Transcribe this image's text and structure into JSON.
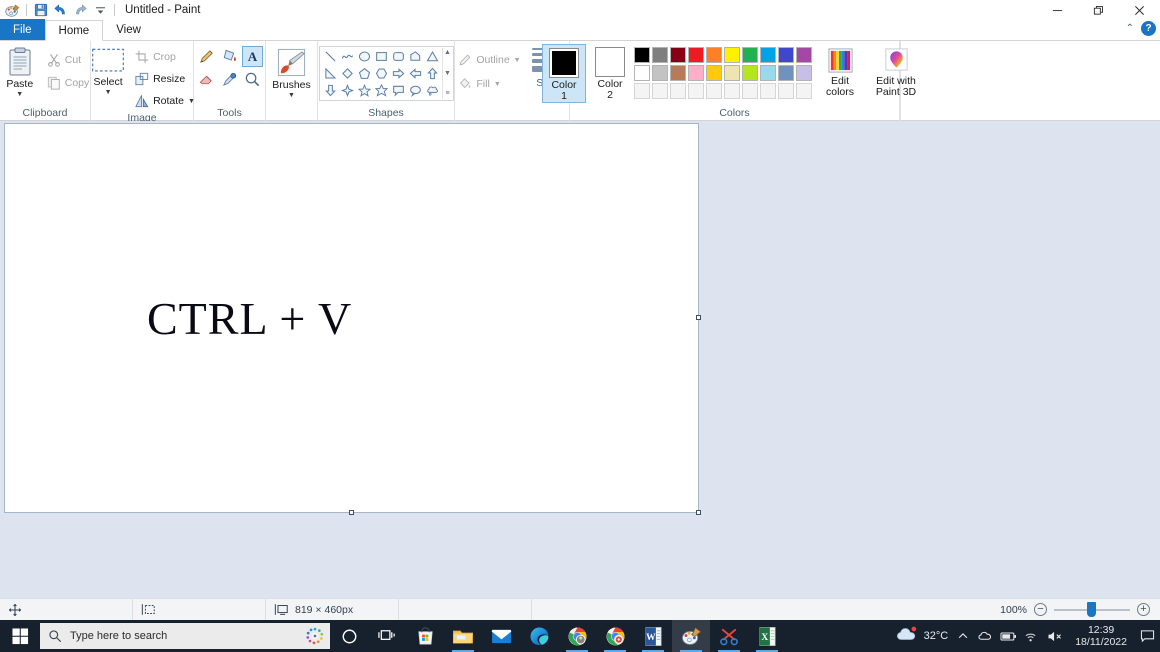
{
  "window": {
    "title": "Untitled - Paint",
    "quick_access": [
      {
        "name": "paint-app-icon",
        "glyph": "paint"
      },
      {
        "name": "save-icon",
        "glyph": "save"
      },
      {
        "name": "undo-icon",
        "glyph": "undo"
      },
      {
        "name": "redo-icon",
        "glyph": "redo"
      },
      {
        "name": "customize-qat-icon",
        "glyph": "chevron-down-bar"
      }
    ],
    "controls": {
      "minimize": "—",
      "restore": "❐",
      "close": "✕",
      "collapse_ribbon": "⌃",
      "help": "?"
    }
  },
  "tabs": [
    {
      "label": "File",
      "state": "file"
    },
    {
      "label": "Home",
      "state": "active"
    },
    {
      "label": "View",
      "state": "normal"
    }
  ],
  "ribbon": {
    "clipboard": {
      "label": "Clipboard",
      "paste": {
        "label": "Paste",
        "has_caret": true
      },
      "cut": {
        "label": "Cut",
        "disabled": true
      },
      "copy": {
        "label": "Copy",
        "disabled": true
      }
    },
    "image": {
      "label": "Image",
      "select": {
        "label": "Select",
        "has_caret": true
      },
      "crop": {
        "label": "Crop",
        "disabled": true
      },
      "resize": {
        "label": "Resize",
        "disabled": false
      },
      "rotate": {
        "label": "Rotate",
        "disabled": false,
        "has_caret": true
      }
    },
    "tools": {
      "label": "Tools",
      "items": [
        {
          "name": "pencil-tool",
          "selected": false
        },
        {
          "name": "fill-with-color-tool",
          "selected": false
        },
        {
          "name": "text-tool",
          "selected": true
        },
        {
          "name": "eraser-tool",
          "selected": false
        },
        {
          "name": "color-picker-tool",
          "selected": false
        },
        {
          "name": "magnifier-tool",
          "selected": false
        }
      ]
    },
    "brushes": {
      "label": "Brushes",
      "has_caret": true
    },
    "shapes": {
      "label": "Shapes",
      "items": [
        "line",
        "curve",
        "oval",
        "rectangle",
        "rounded-rectangle",
        "polygon",
        "triangle",
        "right-triangle",
        "diamond",
        "pentagon",
        "hexagon",
        "right-arrow",
        "left-arrow",
        "up-arrow",
        "down-arrow",
        "four-point-star",
        "five-point-star",
        "six-point-star",
        "rounded-callout",
        "oval-callout",
        "cloud-callout"
      ],
      "scroll": {
        "up": "▲",
        "down": "▼",
        "more": "≡"
      }
    },
    "outline": {
      "label": "Outline",
      "disabled": true,
      "has_caret": true
    },
    "fill": {
      "label": "Fill",
      "disabled": true,
      "has_caret": true
    },
    "size": {
      "label": "Size",
      "has_caret": true,
      "thicknesses": [
        1,
        2,
        3,
        5
      ]
    },
    "colors": {
      "label": "Colors",
      "color1": {
        "label_line1": "Color",
        "label_line2": "1",
        "value": "#000000",
        "selected": true
      },
      "color2": {
        "label_line1": "Color",
        "label_line2": "2",
        "value": "#ffffff",
        "selected": false
      },
      "palette_row1": [
        "#000000",
        "#7f7f7f",
        "#880015",
        "#ed1c24",
        "#ff7f27",
        "#fff200",
        "#22b14c",
        "#00a2e8",
        "#3f48cc",
        "#a349a4"
      ],
      "palette_row2": [
        "#ffffff",
        "#c3c3c3",
        "#b97a57",
        "#ffaec9",
        "#ffc90e",
        "#efe4b0",
        "#b5e61d",
        "#99d9ea",
        "#7092be",
        "#c8bfe7"
      ],
      "palette_row3": [
        "",
        "",
        "",
        "",
        "",
        "",
        "",
        "",
        "",
        ""
      ],
      "edit_colors": {
        "label_line1": "Edit",
        "label_line2": "colors"
      },
      "paint3d": {
        "label_line1": "Edit with",
        "label_line2": "Paint 3D"
      }
    }
  },
  "canvas": {
    "text": "CTRL + V",
    "background": "#ffffff"
  },
  "statusbar": {
    "cursor_position": "",
    "selection_size": "",
    "image_size": "819 × 460px",
    "zoom_level": "100%",
    "zoom_out": "−",
    "zoom_in": "+"
  },
  "taskbar": {
    "search_placeholder": "Type here to search",
    "apps": [
      {
        "name": "cortana-icon",
        "running": false
      },
      {
        "name": "task-view-icon",
        "running": false
      },
      {
        "name": "microsoft-store-icon",
        "running": false
      },
      {
        "name": "file-explorer-icon",
        "running": true
      },
      {
        "name": "mail-icon",
        "running": false
      },
      {
        "name": "microsoft-edge-icon",
        "running": false
      },
      {
        "name": "google-chrome-icon",
        "running": true
      },
      {
        "name": "google-chrome-icon-2",
        "running": true
      },
      {
        "name": "microsoft-word-icon",
        "running": true
      },
      {
        "name": "paint-icon",
        "running": true,
        "active": true
      },
      {
        "name": "snipping-tool-icon",
        "running": true
      },
      {
        "name": "microsoft-excel-icon",
        "running": true
      }
    ],
    "weather": {
      "temperature": "32°C"
    },
    "tray": [
      {
        "name": "show-hidden-icons-icon",
        "glyph": "⌃"
      },
      {
        "name": "onedrive-icon",
        "glyph": "onedrive"
      },
      {
        "name": "battery-icon",
        "glyph": "battery"
      },
      {
        "name": "wifi-icon",
        "glyph": "wifi"
      },
      {
        "name": "volume-muted-icon",
        "glyph": "volume-mute"
      }
    ],
    "clock": {
      "time": "12:39",
      "date": "18/11/2022"
    },
    "action_center": "▭"
  }
}
